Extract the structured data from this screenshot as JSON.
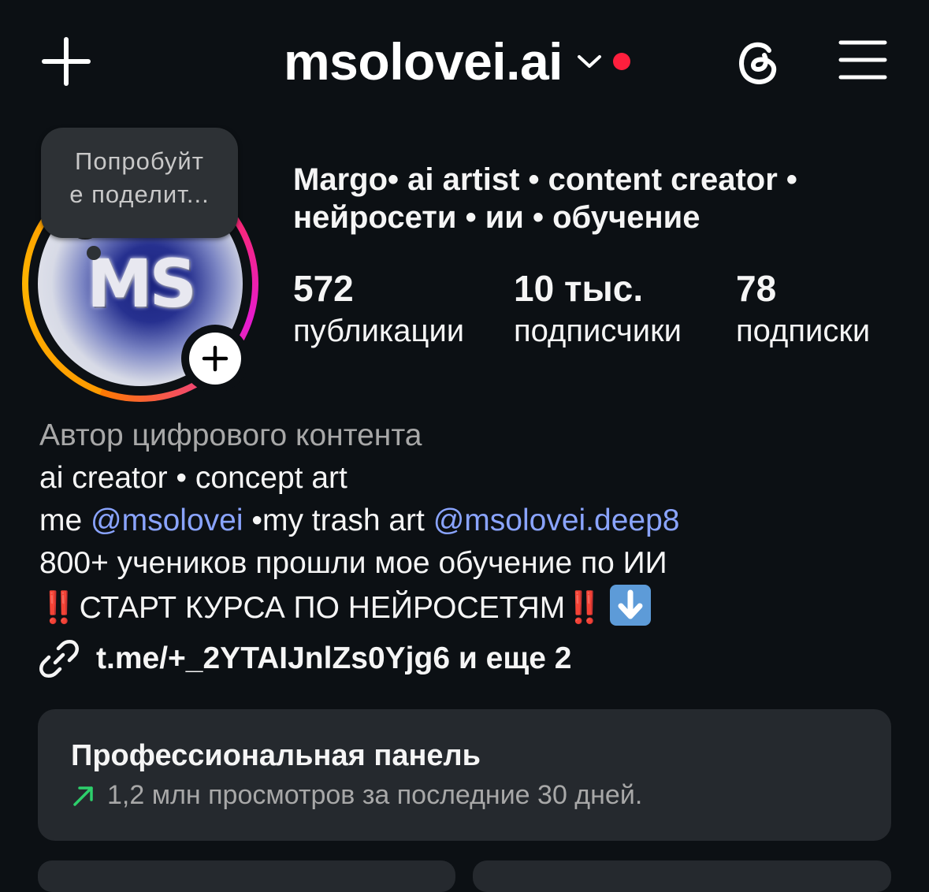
{
  "header": {
    "username": "msolovei.ai",
    "icons": [
      "plus-icon",
      "chevron-down-icon",
      "threads-icon",
      "hamburger-menu-icon"
    ],
    "notification_dot_color": "#ff1f3d"
  },
  "tooltip": {
    "text": "Попробуйт\nе поделит..."
  },
  "avatar": {
    "initials": "MS"
  },
  "profile": {
    "name": "Margo• ai artist • content creator • нейросети • ии • обучение"
  },
  "stats": [
    {
      "value": "572",
      "label": "публикации"
    },
    {
      "value": "10 тыс.",
      "label": "подписчики"
    },
    {
      "value": "78",
      "label": "подписки"
    }
  ],
  "bio": {
    "category": "Автор цифрового контента",
    "line1": "ai creator • concept art",
    "line2_prefix": "me ",
    "mention1": "@msolovei",
    "line2_middle": " •my trash art ",
    "mention2": "@msolovei.deep8",
    "line3": "800+ учеников прошли мое обучение по ИИ",
    "line4_bang1": "‼️",
    "line4_text": "СТАРТ КУРСА ПО НЕЙРОСЕТЯМ",
    "line4_bang2": "‼️"
  },
  "link": {
    "text": "t.me/+_2YTAIJnlZs0Yjg6 и еще 2"
  },
  "pro_panel": {
    "title": "Профессиональная панель",
    "subtitle": "1,2 млн просмотров за последние 30 дней.",
    "trend_color": "#2dcf6b"
  }
}
